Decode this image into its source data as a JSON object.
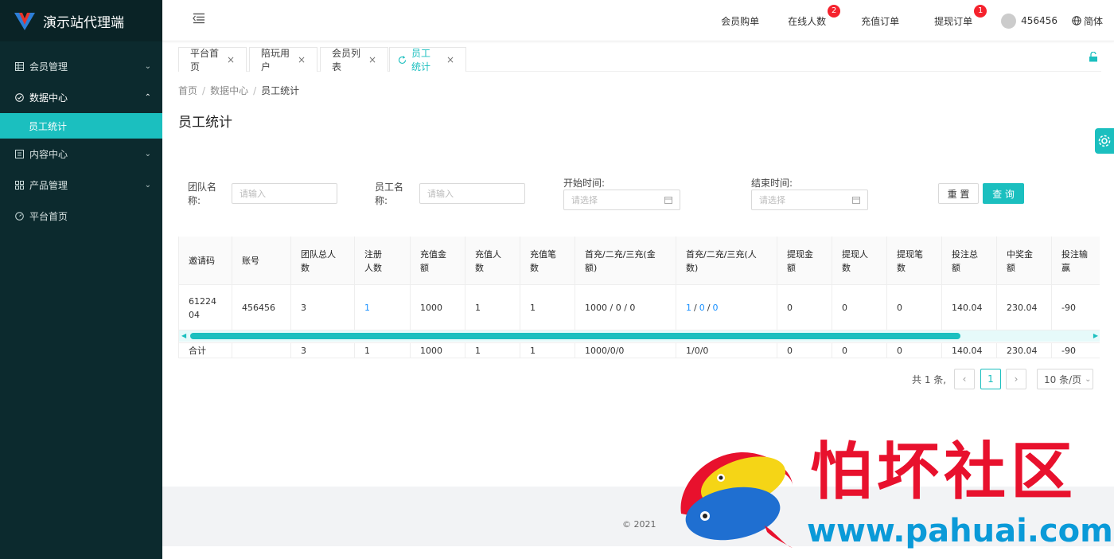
{
  "sidebar": {
    "title": "演示站代理端",
    "items": [
      {
        "label": "会员管理",
        "icon": "grid-icon"
      },
      {
        "label": "数据中心",
        "icon": "check-circle-icon"
      },
      {
        "label": "内容中心",
        "icon": "list-icon"
      },
      {
        "label": "产品管理",
        "icon": "apps-icon"
      },
      {
        "label": "平台首页",
        "icon": "dashboard-icon"
      }
    ],
    "submenu": {
      "label": "员工统计"
    }
  },
  "header": {
    "links": [
      "会员购单",
      "在线人数",
      "充值订单",
      "提现订单"
    ],
    "online_badge": "2",
    "withdraw_badge": "1",
    "username": "456456",
    "language": "简体"
  },
  "tabs": [
    {
      "label": "平台首页"
    },
    {
      "label": "陪玩用户"
    },
    {
      "label": "会员列表"
    },
    {
      "label": "员工统计"
    }
  ],
  "breadcrumb": {
    "home": "首页",
    "section": "数据中心",
    "current": "员工统计"
  },
  "page_title": "员工统计",
  "filters": {
    "team_label": "团队名称:",
    "team_placeholder": "请输入",
    "staff_label": "员工名称:",
    "staff_placeholder": "请输入",
    "start_label": "开始时间:",
    "start_placeholder": "请选择",
    "end_label": "结束时间:",
    "end_placeholder": "请选择",
    "reset": "重 置",
    "query": "查 询"
  },
  "table": {
    "columns": [
      "邀请码",
      "账号",
      "团队总人数",
      "注册人数",
      "充值金额",
      "充值人数",
      "充值笔数",
      "首充/二充/三充(金额)",
      "首充/二充/三充(人数)",
      "提现金额",
      "提现人数",
      "提现笔数",
      "投注总额",
      "中奖金额",
      "投注输赢"
    ],
    "row": {
      "invite_code": "6122404",
      "account": "456456",
      "team_total": "3",
      "registered": "1",
      "recharge_amount": "1000",
      "recharge_users": "1",
      "recharge_count": "1",
      "first_amounts": "1000 / 0 / 0",
      "first_users": [
        "1",
        "0",
        "0"
      ],
      "withdraw_amount": "0",
      "withdraw_users": "0",
      "withdraw_count": "0",
      "bet_total": "140.04",
      "win_amount": "230.04",
      "bet_result": "-90"
    },
    "total": {
      "label": "合计",
      "team_total": "3",
      "registered": "1",
      "recharge_amount": "1000",
      "recharge_users": "1",
      "recharge_count": "1",
      "first_amounts": "1000/0/0",
      "first_users": "1/0/0",
      "withdraw_amount": "0",
      "withdraw_users": "0",
      "withdraw_count": "0",
      "bet_total": "140.04",
      "win_amount": "230.04",
      "bet_result": "-90"
    }
  },
  "pagination": {
    "total": "共 1 条,",
    "current": "1",
    "page_size": "10 条/页"
  },
  "footer": {
    "copyright": "2021"
  },
  "watermark": {
    "cn": "怕坏社区",
    "url": "www.pahuai.com"
  },
  "colors": {
    "accent": "#1bbfbf",
    "sidebar": "#0c2a2e",
    "link": "#1890ff",
    "badge": "#f5222d"
  }
}
